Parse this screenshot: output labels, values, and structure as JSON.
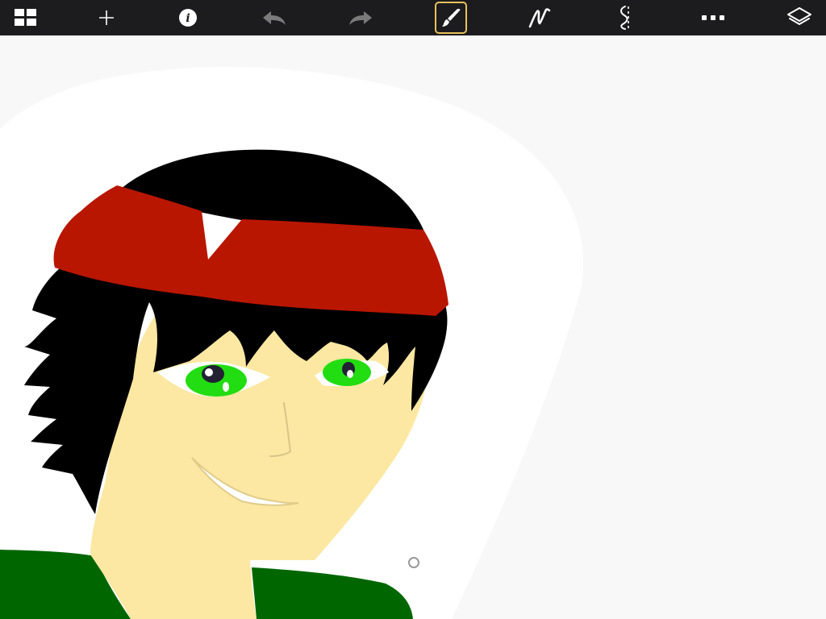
{
  "app": {
    "name": "drawing-app",
    "active_tool": "brush"
  },
  "toolbar": {
    "items": [
      {
        "icon": "gallery-grid-icon",
        "action": "gallery"
      },
      {
        "icon": "plus-icon",
        "action": "new-canvas"
      },
      {
        "icon": "info-icon",
        "action": "info"
      },
      {
        "icon": "undo-arrow-icon",
        "action": "undo",
        "enabled": false
      },
      {
        "icon": "redo-arrow-icon",
        "action": "redo",
        "enabled": false
      },
      {
        "icon": "brush-icon",
        "action": "brush",
        "selected": true
      },
      {
        "icon": "pen-stroke-icon",
        "action": "stroke"
      },
      {
        "icon": "symmetry-icon",
        "action": "symmetry"
      },
      {
        "icon": "more-dots-icon",
        "action": "more"
      },
      {
        "icon": "layers-icon",
        "action": "layers"
      }
    ],
    "info_glyph": "i"
  },
  "colors": {
    "toolbar_bg": "#1c1c1e",
    "icon": "#ffffff",
    "icon_disabled": "#7a7a7a",
    "active_outline": "#e8c25a",
    "canvas_bg": "#ffffff",
    "skin": "#fce8a2",
    "hair": "#000000",
    "headband": "#b91600",
    "eyes": "#22dd11",
    "shirt": "#006600"
  }
}
